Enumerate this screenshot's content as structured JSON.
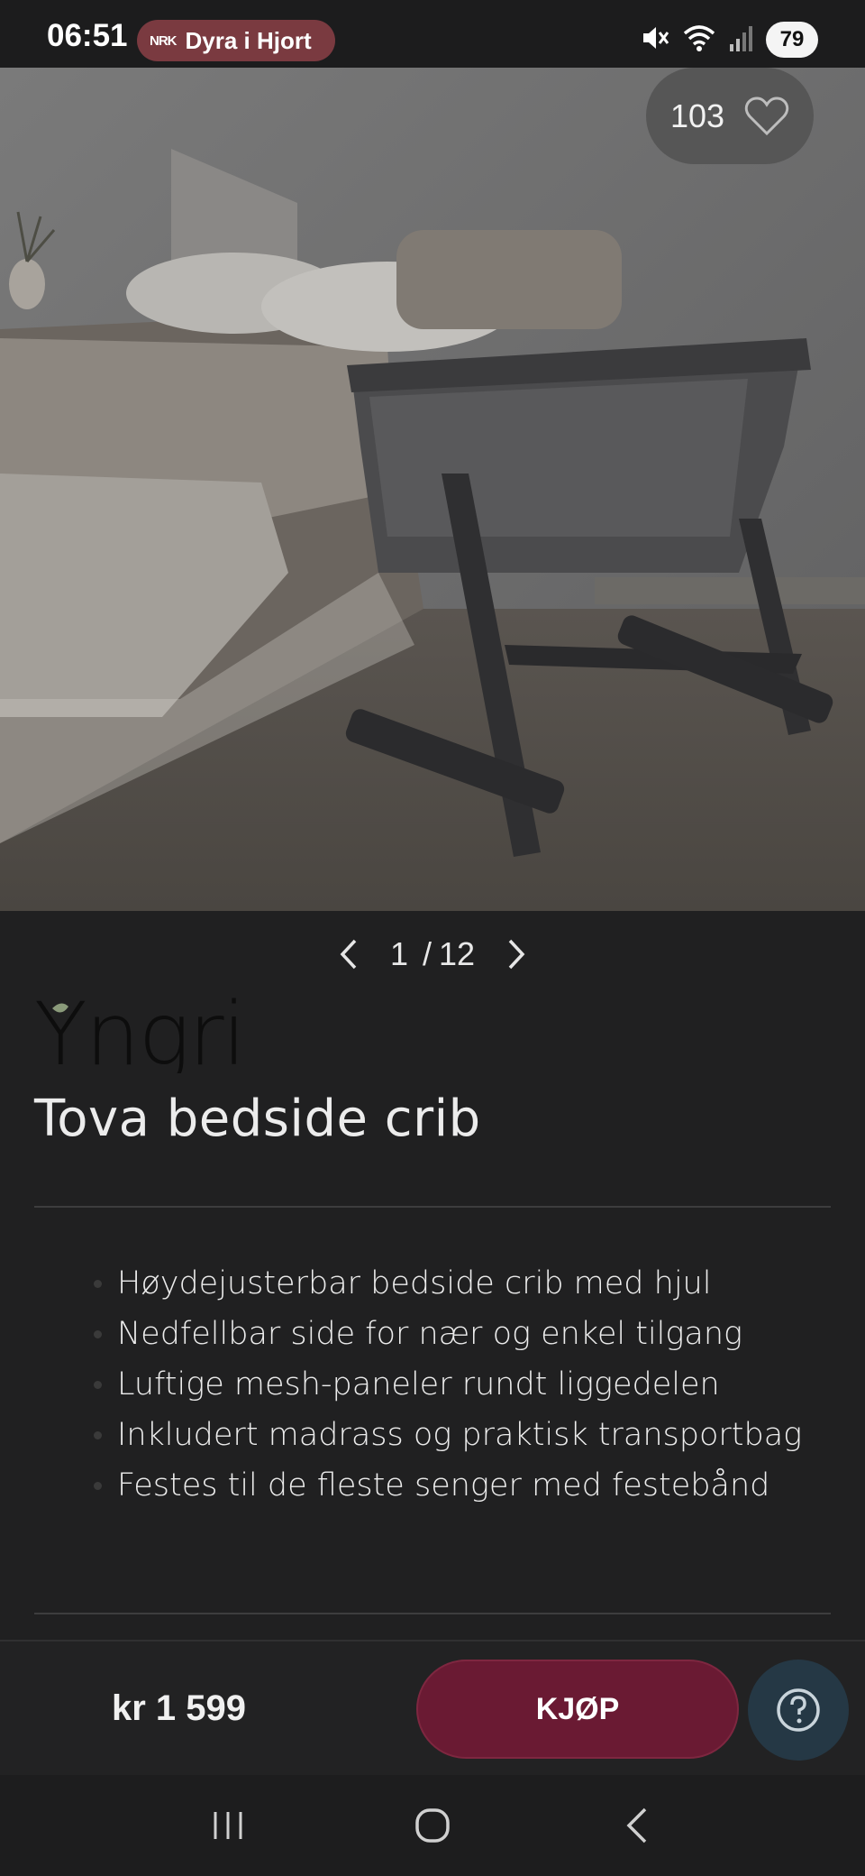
{
  "status_bar": {
    "time": "06:51",
    "now_playing_logo": "NRK",
    "now_playing_title": "Dyra i Hjort",
    "battery": "79",
    "icons": [
      "mute-icon",
      "wifi-icon",
      "signal-icon",
      "battery-icon"
    ]
  },
  "gallery": {
    "favorites_count": "103",
    "current_page": "1",
    "separator": "/",
    "total_pages": "12"
  },
  "product": {
    "brand": "Yngri",
    "title": "Tova bedside crib",
    "features": [
      "Høydejusterbar bedside crib med hjul",
      "Nedfellbar side for nær og enkel tilgang",
      "Luftige mesh-paneler rundt liggedelen",
      "Inkludert madrass og praktisk transportbag",
      "Festes til de fleste senger med festebånd"
    ]
  },
  "buy_bar": {
    "price": "kr 1 599",
    "buy_label": "KJØP"
  },
  "colors": {
    "background": "#202021",
    "buy_button": "#6a1a33",
    "help_button": "#253845"
  }
}
